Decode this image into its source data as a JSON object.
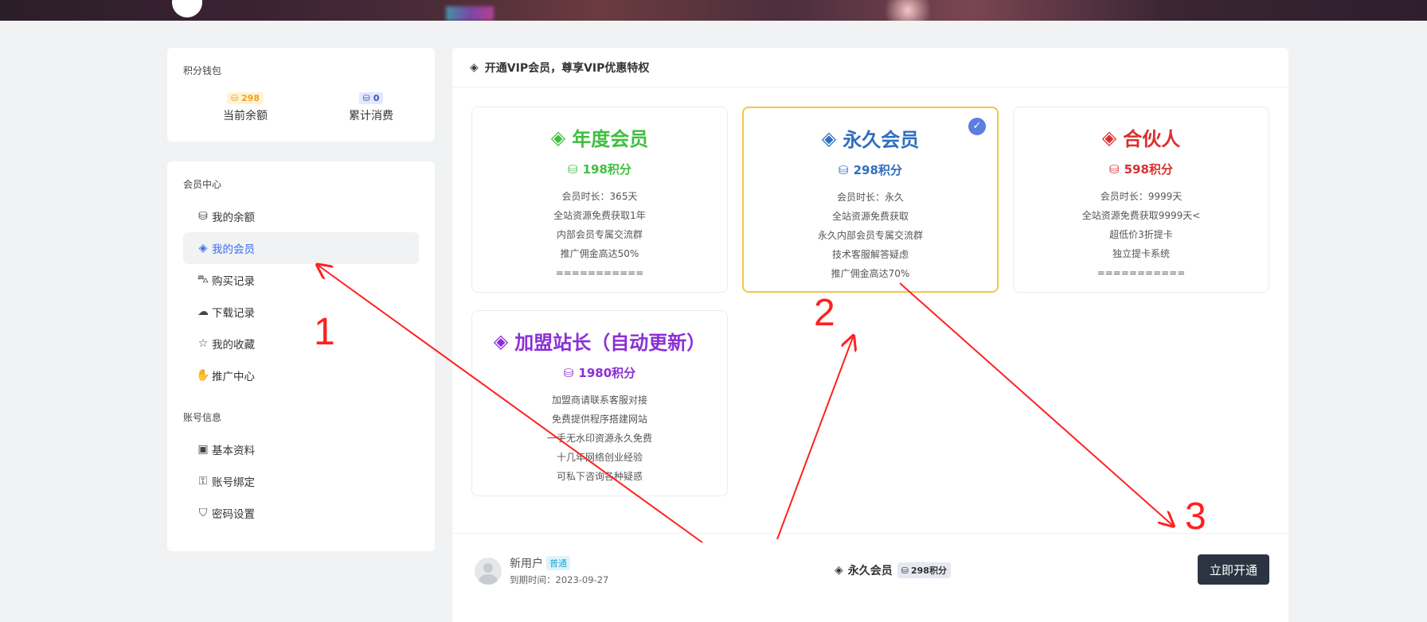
{
  "wallet": {
    "title": "积分钱包",
    "balance_value": "298",
    "balance_label": "当前余额",
    "spent_value": "0",
    "spent_label": "累计消费"
  },
  "member_center": {
    "title": "会员中心",
    "items": [
      {
        "label": "我的余额",
        "icon": "coins-icon"
      },
      {
        "label": "我的会员",
        "icon": "diamond-icon",
        "active": true
      },
      {
        "label": "购买记录",
        "icon": "basket-icon"
      },
      {
        "label": "下载记录",
        "icon": "cloud-download-icon"
      },
      {
        "label": "我的收藏",
        "icon": "star-icon"
      },
      {
        "label": "推广中心",
        "icon": "hand-coin-icon"
      }
    ]
  },
  "account_info": {
    "title": "账号信息",
    "items": [
      {
        "label": "基本资料",
        "icon": "id-card-icon"
      },
      {
        "label": "账号绑定",
        "icon": "bind-icon"
      },
      {
        "label": "密码设置",
        "icon": "shield-icon"
      }
    ]
  },
  "main": {
    "header": "开通VIP会员，尊享VIP优惠特权",
    "plans": [
      {
        "name": "年度会员",
        "price": "198积分",
        "color": "#3fbf3f",
        "features": [
          "会员时长：365天",
          "全站资源免费获取1年",
          "内部会员专属交流群",
          "推广佣金高达50%",
          "==========="
        ],
        "selected": false
      },
      {
        "name": "永久会员",
        "price": "298积分",
        "color": "#2f6fbf",
        "features": [
          "会员时长：永久",
          "全站资源免费获取",
          "永久内部会员专属交流群",
          "技术客服解答疑虑",
          "推广佣金高达70%"
        ],
        "selected": true
      },
      {
        "name": "合伙人",
        "price": "598积分",
        "color": "#d9302f",
        "features": [
          "会员时长：9999天",
          "全站资源免费获取9999天<",
          "超低价3折提卡",
          "独立提卡系统",
          "==========="
        ],
        "selected": false
      },
      {
        "name": "加盟站长（自动更新）",
        "price": "1980积分",
        "color": "#8a2fd6",
        "features": [
          "加盟商请联系客服对接",
          "免费提供程序搭建网站",
          "一手无水印资源永久免费",
          "十几年网络创业经验",
          "可私下咨询各种疑惑"
        ],
        "selected": false
      }
    ],
    "footer": {
      "username": "新用户",
      "user_tag": "普通",
      "expire": "到期时间：2023-09-27",
      "selected_plan": "永久会员",
      "selected_price": "298积分",
      "buy_label": "立即开通"
    }
  },
  "annotations": {
    "labels": [
      "1",
      "2",
      "3"
    ],
    "color": "#ff2020"
  }
}
